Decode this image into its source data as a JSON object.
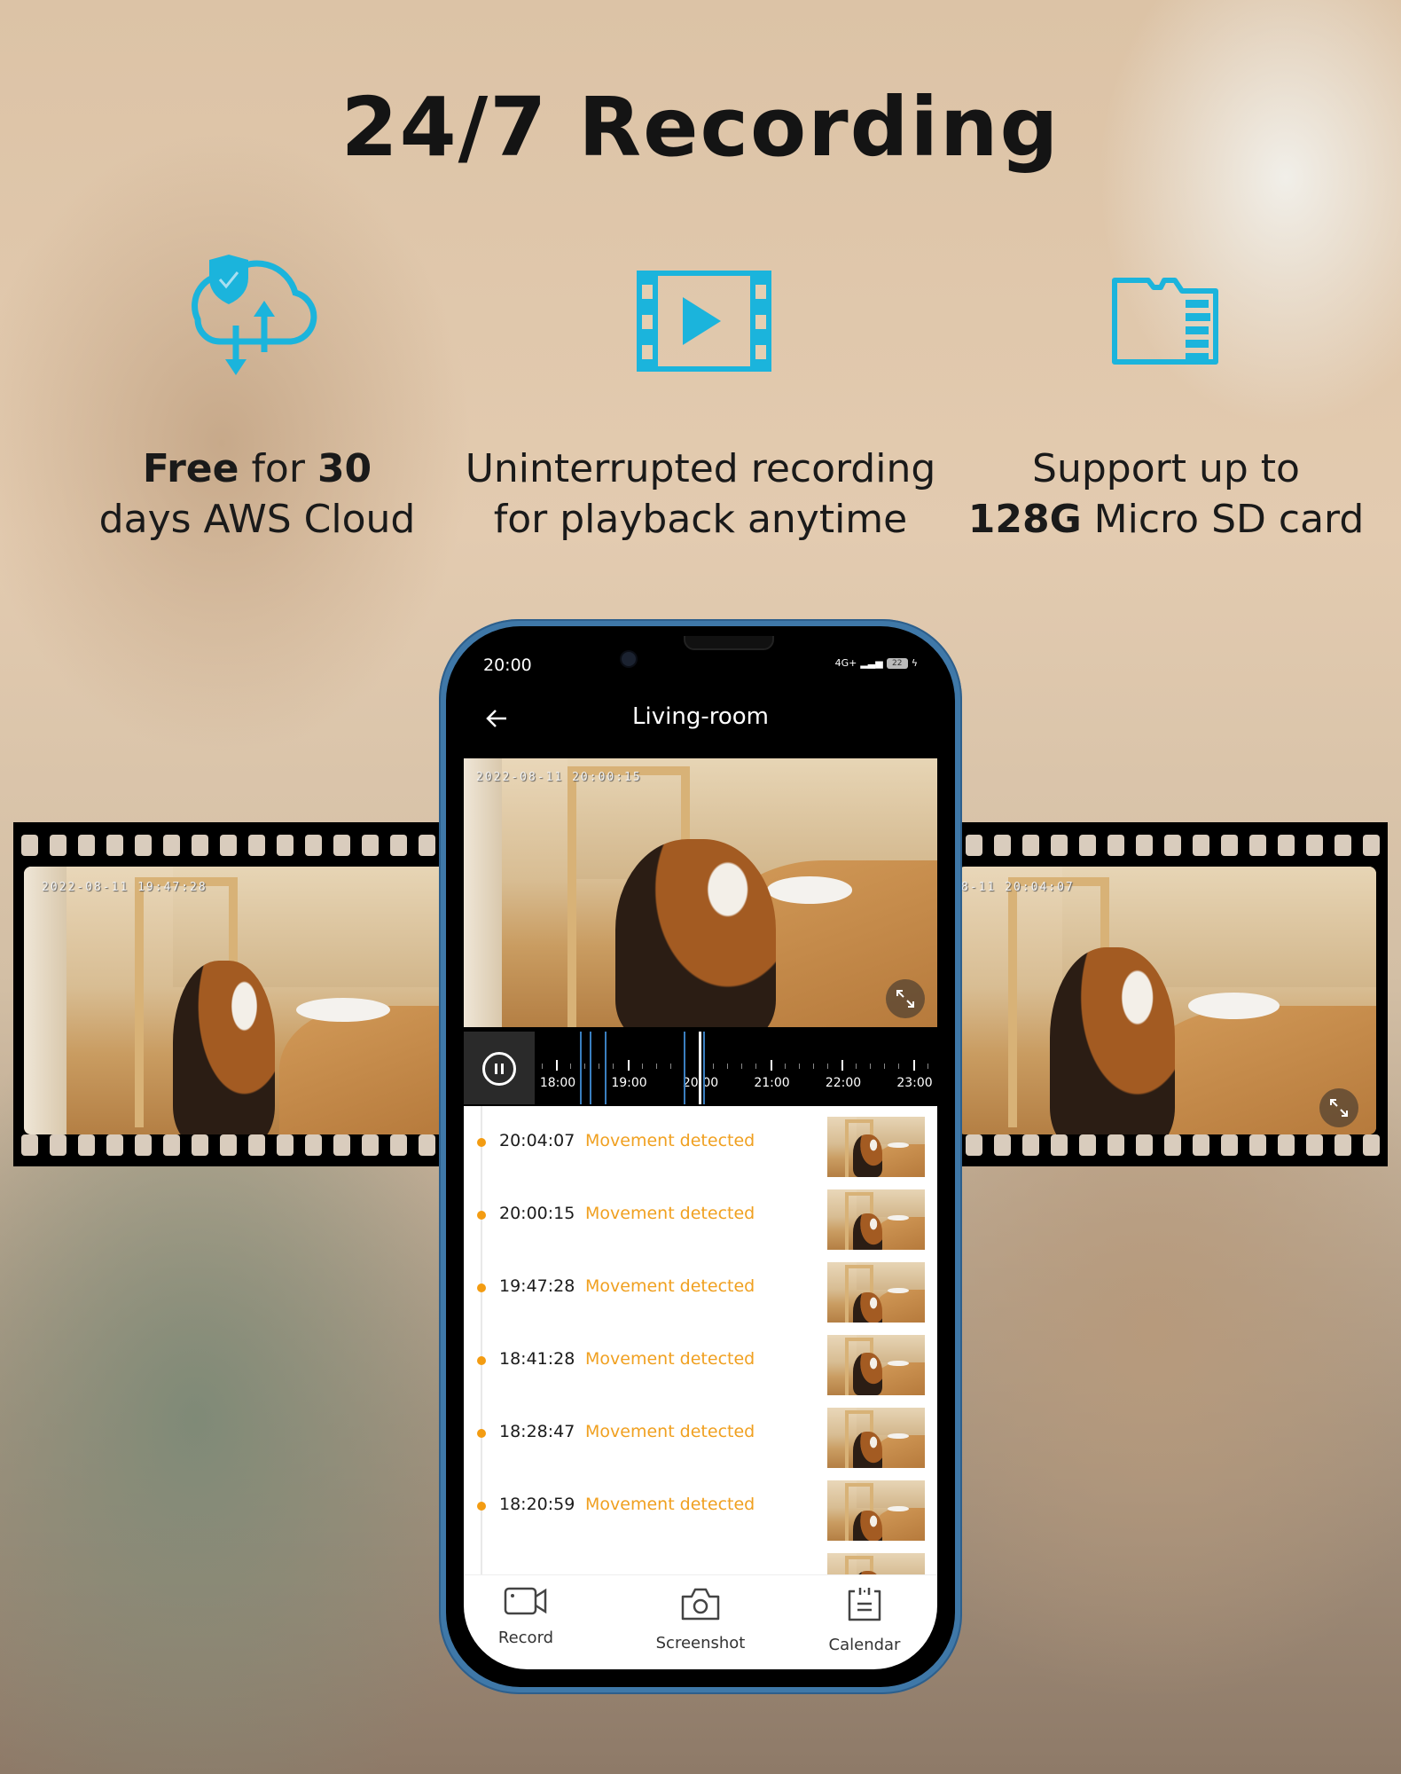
{
  "title": "24/7 Recording",
  "features": [
    {
      "icon": "cloud-shield-upload-download-icon",
      "line1_bold": "Free",
      "line1_mid": " for ",
      "line1_bold2": "30",
      "line2": "days AWS Cloud"
    },
    {
      "icon": "video-film-play-icon",
      "line1": "Uninterrupted recording",
      "line2": "for playback anytime"
    },
    {
      "icon": "micro-sd-card-icon",
      "line1": "Support up to",
      "line2_bold": "128G",
      "line2": " Micro SD card"
    }
  ],
  "accent_color": "#1bb4dc",
  "film_left": {
    "timestamp": "2022-08-11   19:47:28"
  },
  "film_right": {
    "timestamp": "8-11   20:04:07"
  },
  "phone": {
    "status": {
      "time": "20:00",
      "network": "4G+",
      "battery": "22"
    },
    "header": {
      "title": "Living-room"
    },
    "video": {
      "timestamp": "2022-08-11   20:00:15"
    },
    "timeline": {
      "labels": [
        "18:00",
        "19:00",
        "20:00",
        "21:00",
        "22:00",
        "23:00"
      ],
      "current": "20:00"
    },
    "events": [
      {
        "time": "20:04:07",
        "label": "Movement detected"
      },
      {
        "time": "20:00:15",
        "label": "Movement detected"
      },
      {
        "time": "19:47:28",
        "label": "Movement detected"
      },
      {
        "time": "18:41:28",
        "label": "Movement detected"
      },
      {
        "time": "18:28:47",
        "label": "Movement detected"
      },
      {
        "time": "18:20:59",
        "label": "Movement detected"
      }
    ],
    "nav": [
      {
        "label": "Record",
        "icon": "video-camera-icon"
      },
      {
        "label": "Screenshot",
        "icon": "camera-icon"
      },
      {
        "label": "Calendar",
        "icon": "calendar-icon"
      }
    ]
  }
}
